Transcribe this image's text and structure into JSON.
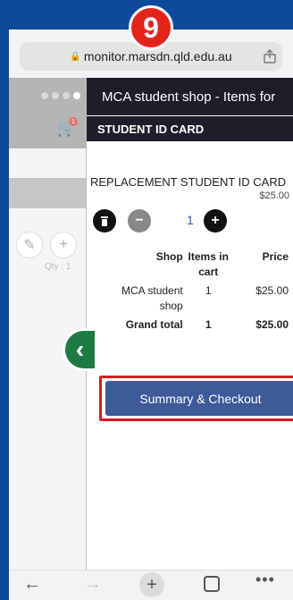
{
  "step_badge": "9",
  "browser": {
    "url": "monitor.marsdn.qld.edu.au",
    "lock_icon": "lock-icon",
    "share_icon": "share-icon"
  },
  "left_pane": {
    "qty_label": "Qty : 1",
    "cart_count": "1"
  },
  "panel": {
    "header_title": "MCA student shop - Items for",
    "section_title": "STUDENT ID CARD",
    "item": {
      "name": "REPLACEMENT STUDENT ID CARD",
      "price": "$25.00",
      "quantity": "1"
    },
    "summary": {
      "columns": [
        "Shop",
        "Items in cart",
        "Price"
      ],
      "rows": [
        {
          "shop": "MCA student shop",
          "items": "1",
          "price": "$25.00"
        }
      ],
      "total": {
        "label": "Grand total",
        "items": "1",
        "price": "$25.00"
      }
    },
    "checkout_label": "Summary & Checkout"
  },
  "toolbar": {
    "back_icon": "back-arrow-icon",
    "forward_icon": "forward-arrow-icon",
    "new_tab_icon": "plus-icon",
    "tabs_icon": "tabs-icon",
    "more_icon": "more-icon"
  },
  "colors": {
    "background": "#0d4a9c",
    "header_bg": "#1e1e2a",
    "checkout_button": "#3d5a99",
    "highlight": "#e0161e",
    "back_tab": "#1e7a43",
    "badge": "#e3241b"
  }
}
